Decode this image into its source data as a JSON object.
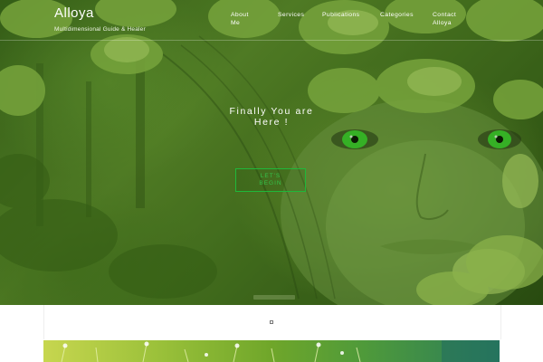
{
  "header": {
    "site_title": "Alloya",
    "tagline": "Multidimensional Guide & Healer"
  },
  "nav": {
    "items": [
      {
        "label_line1": "About",
        "label_line2": "Me"
      },
      {
        "label_line1": "Services",
        "label_line2": ""
      },
      {
        "label_line1": "Publications",
        "label_line2": ""
      },
      {
        "label_line1": "Categories",
        "label_line2": ""
      },
      {
        "label_line1": "Contact",
        "label_line2": "Alloya"
      }
    ]
  },
  "hero": {
    "title_line1": "Finally You are",
    "title_line2": "Here !",
    "cta_line1": "LET'S",
    "cta_line2": "BEGIN",
    "image_icon": "leaf-face-image"
  },
  "colors": {
    "accent": "#34c34a",
    "hero_green": "#4b7a22"
  }
}
